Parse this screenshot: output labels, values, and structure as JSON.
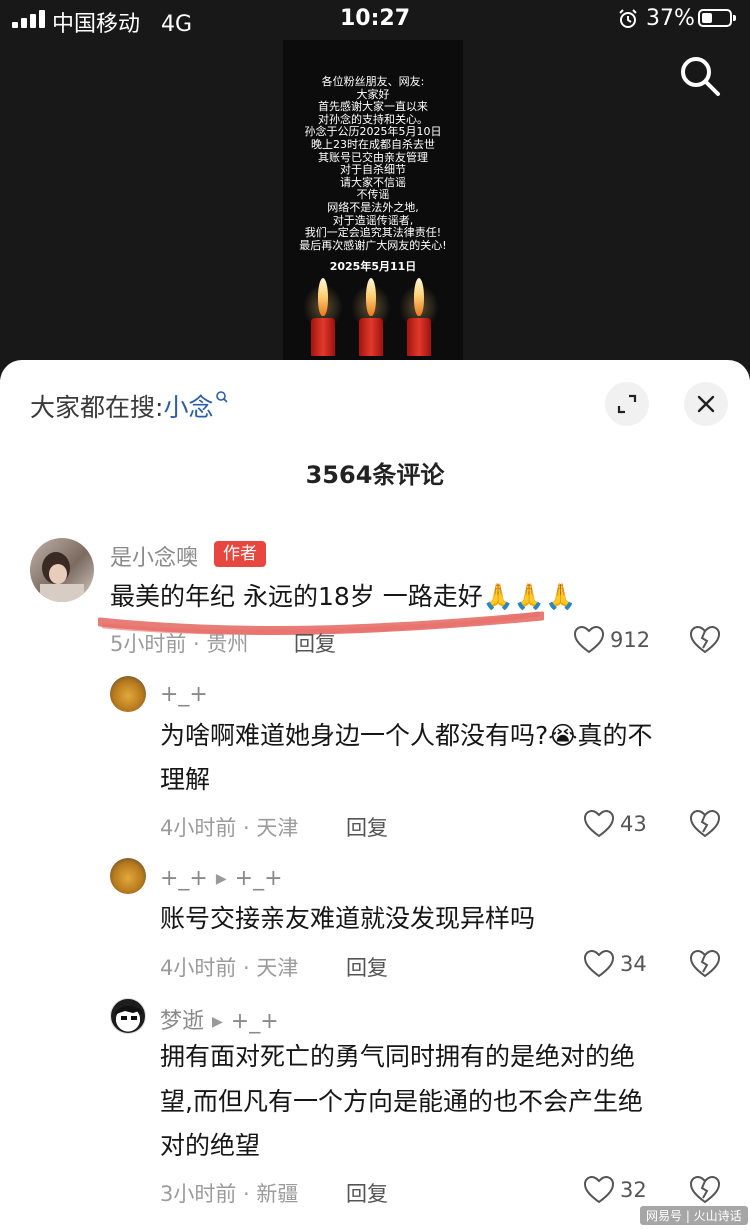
{
  "status_bar": {
    "carrier": "中国移动",
    "network": "4G",
    "time": "10:27",
    "battery_percent": "37%",
    "battery_level": 0.37
  },
  "video": {
    "notice_lines": [
      "各位粉丝朋友、网友:",
      "大家好",
      "首先感谢大家一直以来",
      "对孙念的支持和关心。",
      "孙念于公历2025年5月10日",
      "晚上23时在成都自杀去世",
      "其账号已交由亲友管理",
      "对于自杀细节",
      "请大家不信谣",
      "不传谣",
      "网络不是法外之地,",
      "对于造谣传谣者,",
      "我们一定会追究其法律责任!",
      "最后再次感谢广大网友的关心!"
    ],
    "notice_date": "2025年5月11日"
  },
  "sheet": {
    "everyone_prefix": "大家都在搜:",
    "everyone_keyword": "小念",
    "comment_count": "3564条评论"
  },
  "comments": [
    {
      "name": "是小念噢",
      "badge": "作者",
      "text": "最美的年纪 永远的18岁 一路走好🙏🙏🙏",
      "meta": "5小时前 · 贵州",
      "reply": "回复",
      "likes": "912"
    },
    {
      "name": "+_+",
      "text_line1": "为啥啊难道她身边一个人都没有吗?😭真的不",
      "text_line2": "理解",
      "meta": "4小时前 · 天津",
      "reply": "回复",
      "likes": "43"
    },
    {
      "name": "+_+",
      "reply_to": "+_+",
      "text": "账号交接亲友难道就没发现异样吗",
      "meta": "4小时前 · 天津",
      "reply": "回复",
      "likes": "34"
    },
    {
      "name": "梦逝",
      "reply_to": "+_+",
      "text_line1": "拥有面对死亡的勇气同时拥有的是绝对的绝",
      "text_line2": "望,而但凡有一个方向是能通的也不会产生绝",
      "text_line3": "对的绝望",
      "meta": "3小时前 · 新疆",
      "reply": "回复",
      "likes": "32"
    }
  ],
  "watermark": "网易号 | 火山诗话",
  "colors": {
    "accent_red": "#e8473f",
    "keyword_blue": "#2c5da7",
    "scribble_red": "#e0504a"
  }
}
